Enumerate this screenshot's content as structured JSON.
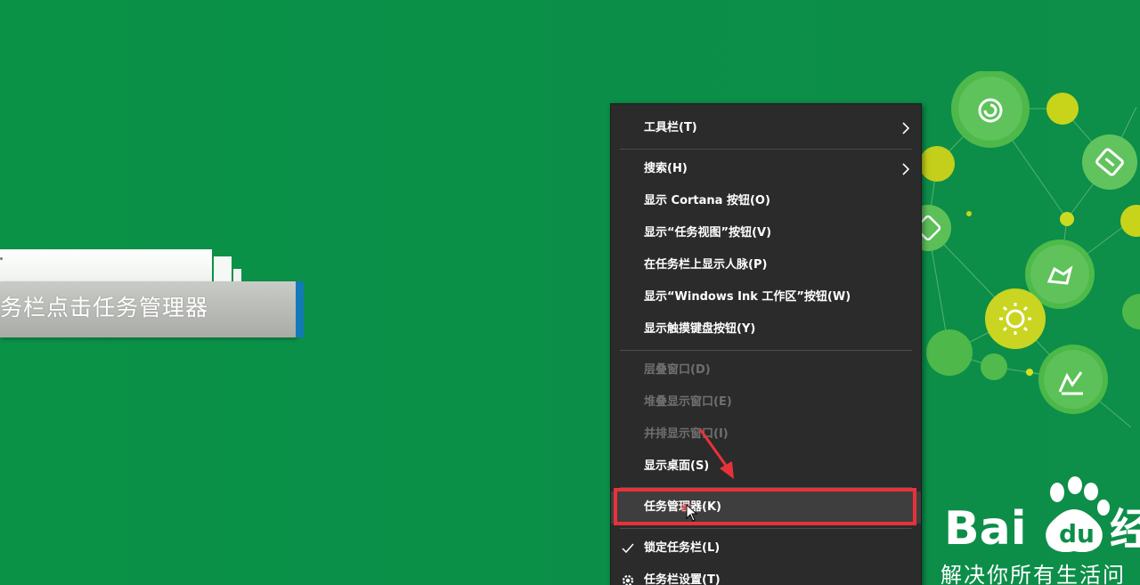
{
  "banner": {
    "text": "务栏点击任务管理器"
  },
  "menu": {
    "items": [
      {
        "label": "工具栏(T)"
      },
      {
        "label": "搜索(H)"
      },
      {
        "label": "显示 Cortana 按钮(O)"
      },
      {
        "label": "显示“任务视图”按钮(V)"
      },
      {
        "label": "在任务栏上显示人脉(P)"
      },
      {
        "label": "显示“Windows Ink 工作区”按钮(W)"
      },
      {
        "label": "显示触摸键盘按钮(Y)"
      },
      {
        "label": "层叠窗口(D)"
      },
      {
        "label": "堆叠显示窗口(E)"
      },
      {
        "label": "并排显示窗口(I)"
      },
      {
        "label": "显示桌面(S)"
      },
      {
        "label": "任务管理器(K)"
      },
      {
        "label": "锁定任务栏(L)"
      },
      {
        "label": "任务栏设置(T)"
      }
    ]
  },
  "baidu": {
    "logo_text": "Bai",
    "logo_du": "du",
    "logo_suffix": "经",
    "slogan": "解决你所有生活问"
  },
  "colors": {
    "background": "#0b8f47",
    "menu_bg": "#2b2b2b",
    "highlight_red": "#e8323a",
    "banner_blue": "#137ab8"
  }
}
